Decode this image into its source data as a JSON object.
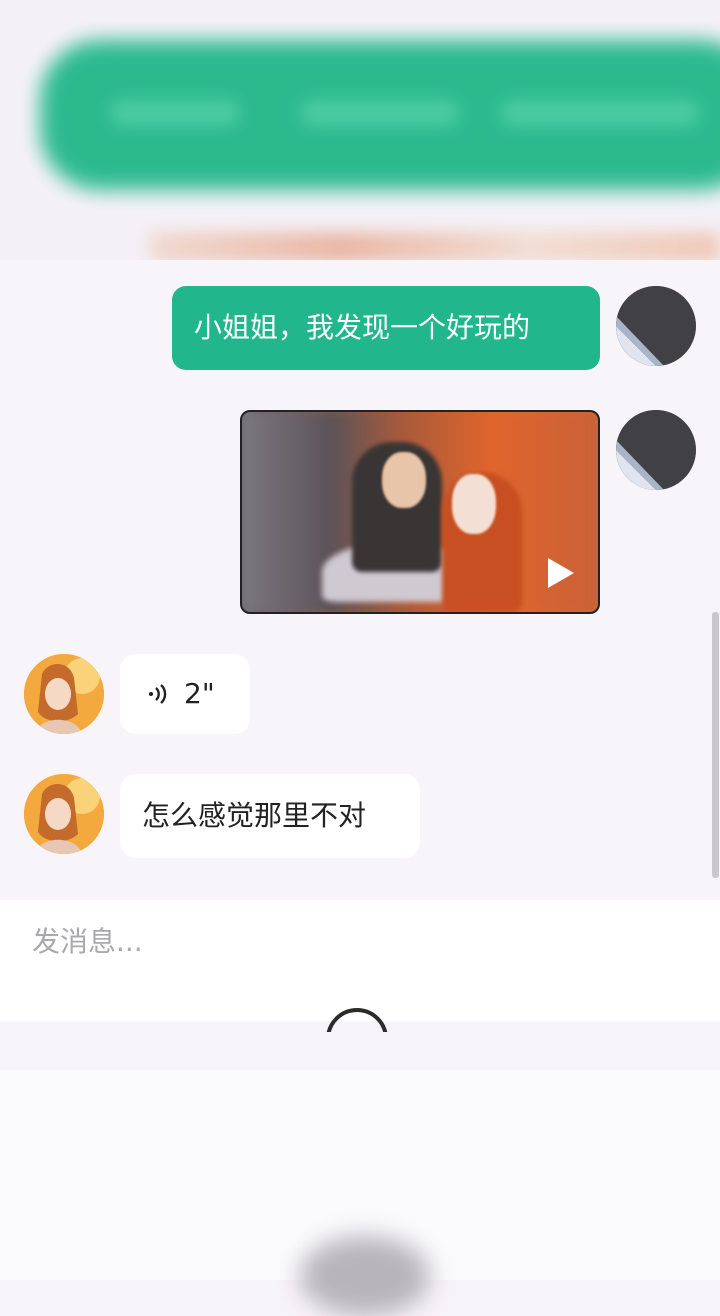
{
  "messages": [
    {
      "side": "right",
      "type": "text",
      "text": "小姐姐，我发现一个好玩的"
    },
    {
      "side": "right",
      "type": "video"
    },
    {
      "side": "left",
      "type": "voice",
      "duration": "2\""
    },
    {
      "side": "left",
      "type": "text",
      "text": "怎么感觉那里不对"
    }
  ],
  "input": {
    "placeholder": "发消息..."
  },
  "colors": {
    "accent_green": "#21b68b",
    "chat_background": "#f8f5fa",
    "incoming_bubble": "#ffffff"
  },
  "icons": [
    "voice-wave-icon",
    "play-icon",
    "emoji-icon"
  ]
}
